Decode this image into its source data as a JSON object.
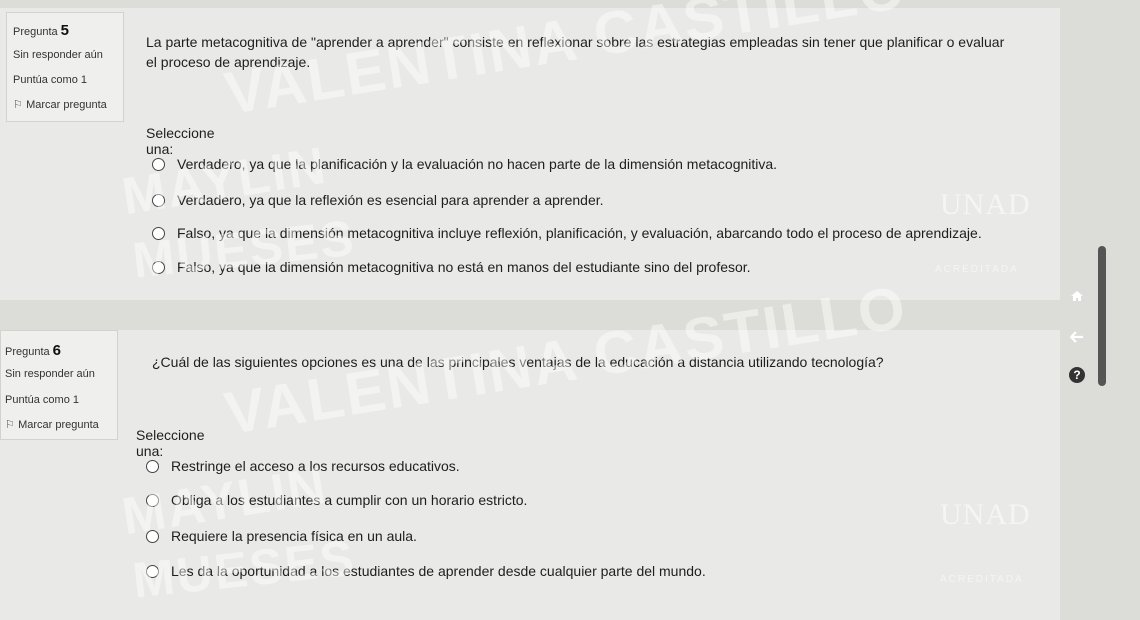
{
  "questions": [
    {
      "number_label": "Pregunta",
      "number": "5",
      "status": "Sin responder aún",
      "score": "Puntúa como 1",
      "flag_label": "Marcar pregunta",
      "text": "La parte metacognitiva de \"aprender a aprender\" consiste en reflexionar sobre las estrategias empleadas sin tener que planificar o evaluar el proceso de aprendizaje.",
      "select_label": "Seleccione una:",
      "options": [
        "Verdadero, ya que la planificación y la evaluación no hacen parte de la dimensión metacognitiva.",
        "Verdadero, ya que la reflexión es esencial para aprender a aprender.",
        "Falso, ya que la dimensión metacognitiva incluye reflexión, planificación, y evaluación, abarcando todo el proceso de aprendizaje.",
        "Falso, ya que la dimensión metacognitiva no está en manos del estudiante sino del profesor."
      ]
    },
    {
      "number_label": "Pregunta",
      "number": "6",
      "status": "Sin responder aún",
      "score": "Puntúa como 1",
      "flag_label": "Marcar pregunta",
      "text": "¿Cuál de las siguientes opciones es una de las principales ventajas de la educación a distancia utilizando tecnología?",
      "select_label": "Seleccione una:",
      "options": [
        "Restringe el acceso a los recursos educativos.",
        "Obliga a los estudiantes a cumplir con un horario estricto.",
        "Requiere la presencia física en un aula.",
        "Les da la oportunidad a los estudiantes de aprender desde cualquier parte del mundo."
      ]
    }
  ],
  "watermark": {
    "line1": "VALENTINA CASTILLO",
    "line2": "MAYLIN",
    "line3": "MUESES",
    "logo": "UNAD",
    "acreditada": "ACREDITADA"
  },
  "icons": {
    "home": "home-icon",
    "back": "arrow-left-icon",
    "help": "help-icon"
  },
  "colors": {
    "background": "#dcdcd8",
    "panel": "#e9e9e7"
  }
}
